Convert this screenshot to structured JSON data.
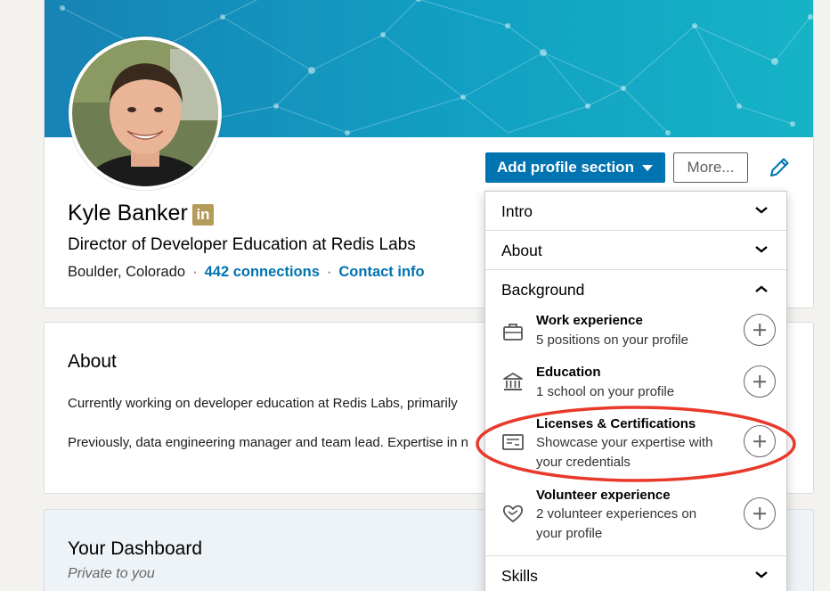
{
  "profile": {
    "name": "Kyle Banker",
    "badge": "in",
    "headline": "Director of Developer Education at Redis Labs",
    "location": "Boulder, Colorado",
    "separator": "·",
    "connections": "442 connections",
    "contact": "Contact info"
  },
  "actions": {
    "add_section": "Add profile section",
    "more": "More..."
  },
  "about": {
    "title": "About",
    "p1": "Currently working on developer education at Redis Labs, primarily",
    "p2": "Previously, data engineering manager and team lead. Expertise in n"
  },
  "dashboard": {
    "title": "Your Dashboard",
    "subtitle": "Private to you"
  },
  "dropdown": {
    "sections": {
      "intro": "Intro",
      "about": "About",
      "background": "Background",
      "skills": "Skills"
    },
    "items": [
      {
        "title": "Work experience",
        "desc": "5 positions on your profile",
        "icon": "briefcase-icon"
      },
      {
        "title": "Education",
        "desc": "1 school on your profile",
        "icon": "school-icon"
      },
      {
        "title": "Licenses & Certifications",
        "desc": "Showcase your expertise with your credentials",
        "icon": "certificate-icon"
      },
      {
        "title": "Volunteer experience",
        "desc": "2 volunteer experiences on your profile",
        "icon": "volunteer-heart-icon"
      }
    ]
  },
  "colors": {
    "primary": "#0073b1",
    "highlight": "#e8392b",
    "badge": "#b59b5a"
  }
}
